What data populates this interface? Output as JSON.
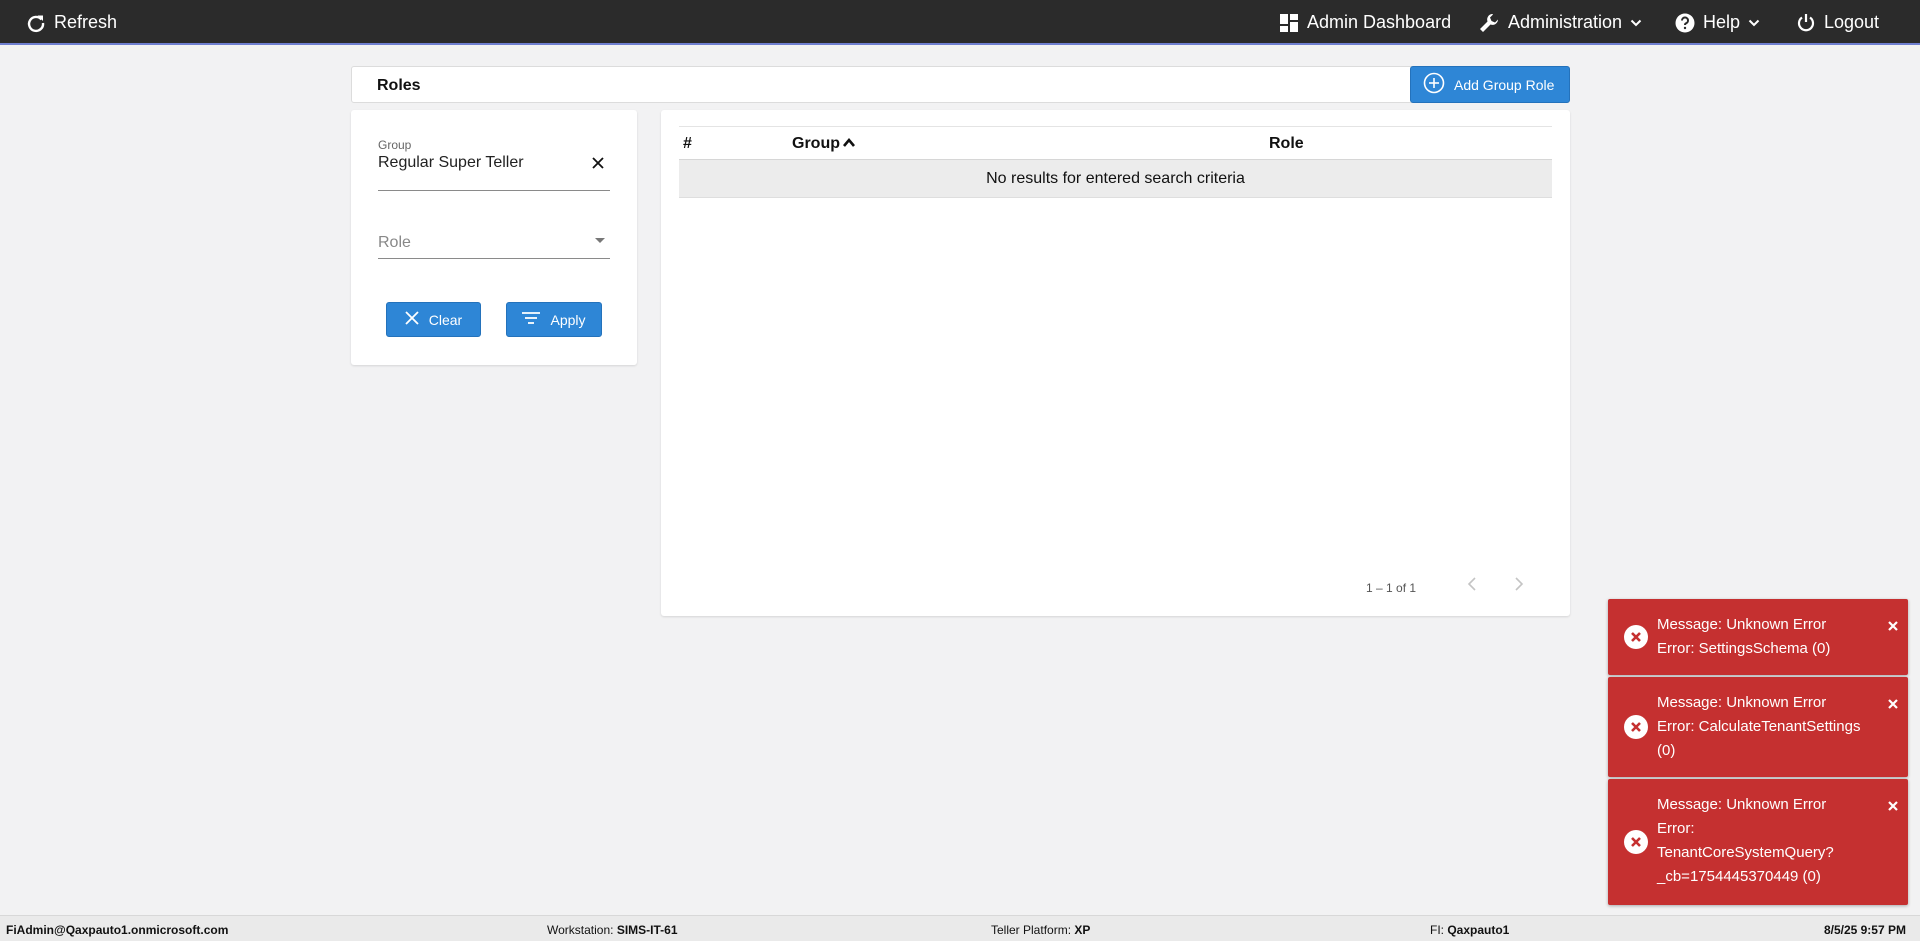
{
  "topbar": {
    "refresh": "Refresh",
    "admin_dashboard": "Admin Dashboard",
    "administration": "Administration",
    "help": "Help",
    "logout": "Logout"
  },
  "header": {
    "title": "Roles",
    "add_button": "Add Group Role"
  },
  "filters": {
    "group_label": "Group",
    "group_value": "Regular Super Teller",
    "role_placeholder": "Role",
    "clear_button": "Clear",
    "apply_button": "Apply"
  },
  "table": {
    "columns": [
      "#",
      "Group",
      "Role"
    ],
    "empty_message": "No results for entered search criteria",
    "pagination": "1 – 1 of 1"
  },
  "toasts": [
    {
      "lines": [
        "Message: Unknown Error",
        "Error: SettingsSchema (0)"
      ]
    },
    {
      "lines": [
        "Message: Unknown Error",
        "Error: CalculateTenantSettings",
        "(0)"
      ]
    },
    {
      "lines": [
        "Message: Unknown Error",
        "Error:",
        "TenantCoreSystemQuery?",
        "_cb=1754445370449 (0)"
      ]
    }
  ],
  "statusbar": {
    "user": "FiAdmin@Qaxpauto1.onmicrosoft.com",
    "workstation_label": "Workstation:",
    "workstation_value": "SIMS-IT-61",
    "platform_label": "Teller Platform:",
    "platform_value": "XP",
    "fi_label": "FI:",
    "fi_value": "Qaxpauto1",
    "datetime": "8/5/25 9:57 PM"
  },
  "colors": {
    "topbar": "#2b2b2b",
    "primary_button": "#2e86d6",
    "toast_error": "#c53030",
    "page_background": "#f2f2f3"
  }
}
